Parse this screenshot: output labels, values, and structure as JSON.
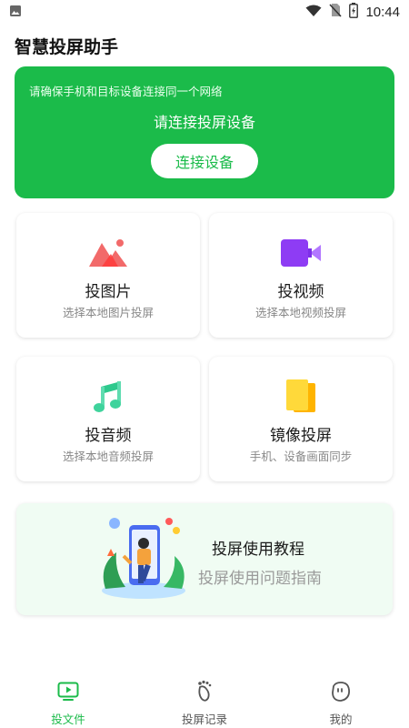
{
  "status_bar": {
    "time": "10:44",
    "icons": [
      "image-icon",
      "wifi-icon",
      "no-sim-icon",
      "battery-charging-icon"
    ]
  },
  "app": {
    "title": "智慧投屏助手"
  },
  "connect_card": {
    "tip": "请确保手机和目标设备连接同一个网络",
    "prompt": "请连接投屏设备",
    "button_label": "连接设备"
  },
  "features": [
    {
      "title": "投图片",
      "subtitle": "选择本地图片投屏",
      "icon": "picture-icon",
      "color": "#f05a5a"
    },
    {
      "title": "投视频",
      "subtitle": "选择本地视频投屏",
      "icon": "video-camera-icon",
      "color": "#8a3cf0"
    },
    {
      "title": "投音频",
      "subtitle": "选择本地音频投屏",
      "icon": "music-note-icon",
      "color": "#3ccf9a"
    },
    {
      "title": "镜像投屏",
      "subtitle": "手机、设备画面同步",
      "icon": "mirror-screen-icon",
      "color": "#f5c518"
    }
  ],
  "tutorial": {
    "title": "投屏使用教程",
    "subtitle": "投屏使用问题指南"
  },
  "bottom_nav": {
    "items": [
      {
        "label": "投文件",
        "icon": "play-screen-icon",
        "active": true
      },
      {
        "label": "投屏记录",
        "icon": "footprint-icon",
        "active": false
      },
      {
        "label": "我的",
        "icon": "profile-face-icon",
        "active": false
      }
    ],
    "accent": "#1bbb4a"
  }
}
